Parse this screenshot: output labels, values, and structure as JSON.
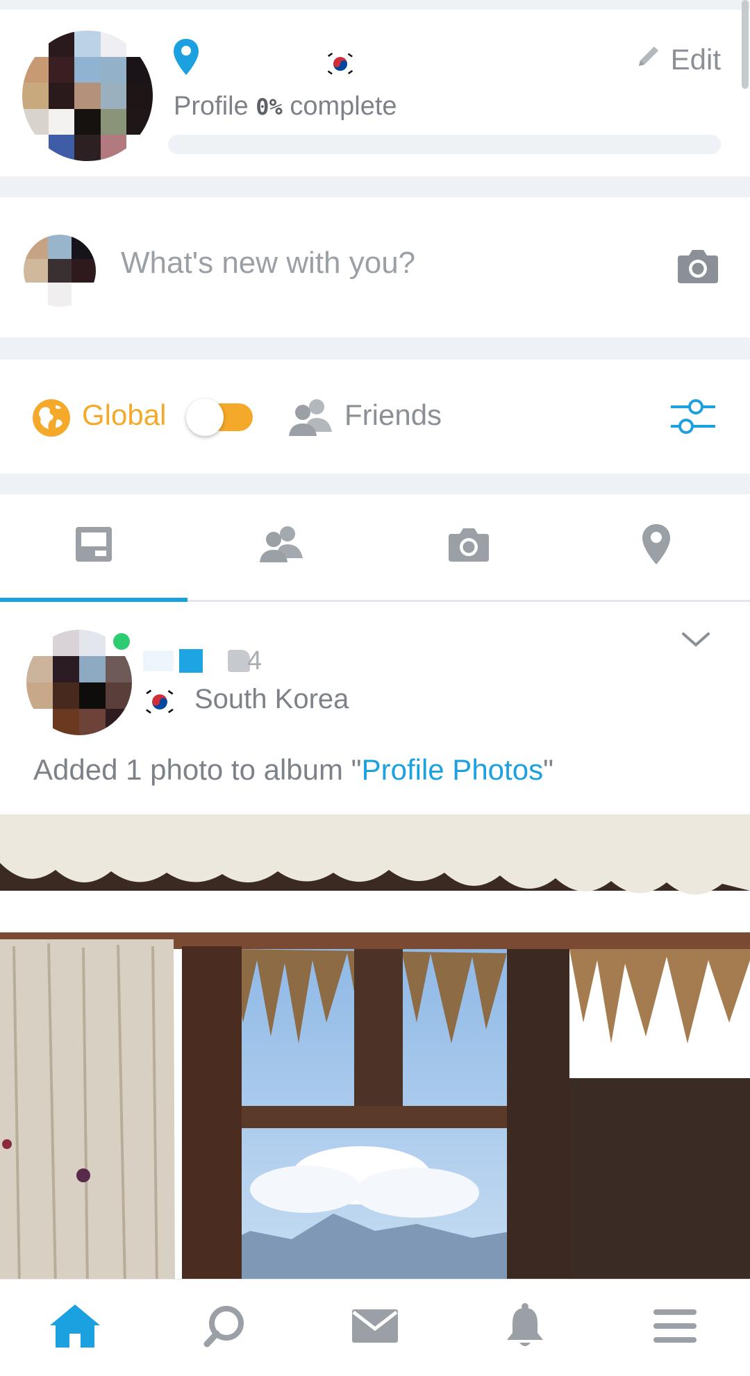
{
  "profile": {
    "edit_label": "Edit",
    "completion_prefix": "Profile",
    "completion_value": "0%",
    "completion_suffix": "complete",
    "completion_fraction": 0,
    "flag_icon": "south-korea-flag-icon",
    "avatar_colors": [
      "#ffffff",
      "#2a1a1e",
      "#bcd3e6",
      "#efeef3",
      "#ffffff",
      "#c79a73",
      "#3a1f22",
      "#8fb3d0",
      "#93b1c9",
      "#1a1418",
      "#c8a97e",
      "#2b1a1c",
      "#b4917a",
      "#9bb0bf",
      "#1e1517",
      "#d8d3cd",
      "#f4f2f0",
      "#15120f",
      "#8a9478",
      "#1f1618",
      "#ffffff",
      "#3f5ca6",
      "#2c2022",
      "#b27a7f",
      "#ffffff"
    ]
  },
  "composer": {
    "placeholder": "What's new with you?",
    "avatar_colors": [
      "#c6a383",
      "#98b5cb",
      "#17131a",
      "#cfb89b",
      "#3a3032",
      "#2e1a1c",
      "#ffffff",
      "#f0eeee",
      "#ffffff"
    ]
  },
  "filter": {
    "global_label": "Global",
    "friends_label": "Friends",
    "toggle_state": "global"
  },
  "tabs": [
    "tab-feed-icon",
    "tab-people-icon",
    "tab-photos-icon",
    "tab-places-icon"
  ],
  "post": {
    "username_visible": "4",
    "location": "South Korea",
    "text_prefix": "Added 1 photo to album \"",
    "album_name": "Profile Photos",
    "text_suffix": "\"",
    "avatar_colors": [
      "#ffffff",
      "#d9d3d8",
      "#e4e6ee",
      "#ffffff",
      "#cbb49b",
      "#2a1c22",
      "#8eaac3",
      "#6e5a56",
      "#c7a888",
      "#47291e",
      "#0f0c0c",
      "#5a3e3a",
      "#ffffff",
      "#6b3820",
      "#6d4238",
      "#2e1c1e"
    ]
  },
  "bottom_nav": [
    "home-icon",
    "search-icon",
    "messages-icon",
    "notifications-icon",
    "menu-icon"
  ],
  "colors": {
    "accent": "#1ca1e0",
    "global": "#f5a92a",
    "online": "#2ecc71",
    "muted": "#8b9097"
  }
}
